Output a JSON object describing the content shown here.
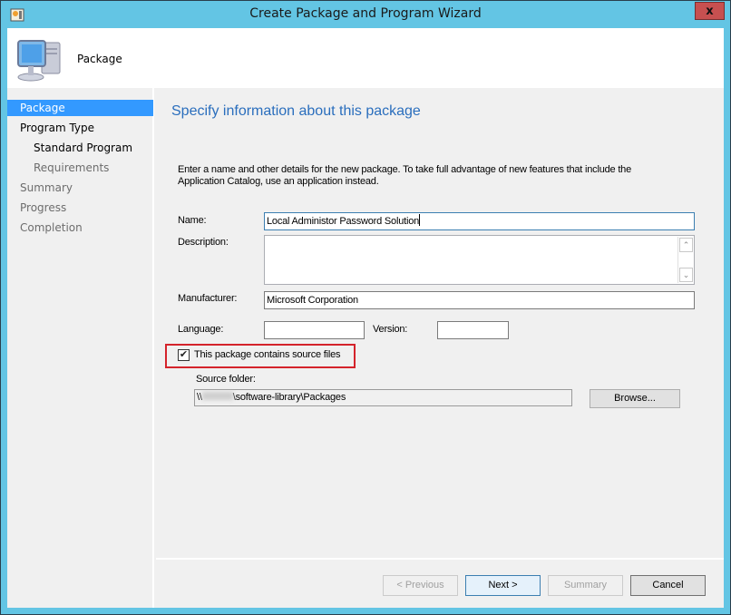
{
  "window": {
    "title": "Create Package and Program Wizard",
    "close_label": "x"
  },
  "header": {
    "title": "Package",
    "icon": "computer-icon"
  },
  "nav": {
    "items": [
      {
        "label": "Package",
        "state": "active"
      },
      {
        "label": "Program Type",
        "state": "normal"
      },
      {
        "label": "Standard Program",
        "state": "sub-normal"
      },
      {
        "label": "Requirements",
        "state": "sub-dim"
      },
      {
        "label": "Summary",
        "state": "dim"
      },
      {
        "label": "Progress",
        "state": "dim"
      },
      {
        "label": "Completion",
        "state": "dim"
      }
    ]
  },
  "page": {
    "heading": "Specify information about this package",
    "intro": "Enter a name and other details for the new package. To take full advantage of new features that include the Application Catalog, use an application instead.",
    "fields": {
      "name_label": "Name:",
      "name_value": "Local Administor Password Solution",
      "description_label": "Description:",
      "description_value": "",
      "manufacturer_label": "Manufacturer:",
      "manufacturer_value": "Microsoft Corporation",
      "language_label": "Language:",
      "language_value": "",
      "version_label": "Version:",
      "version_value": ""
    },
    "source_files": {
      "checkbox_label": "This package contains source files",
      "checked": true,
      "folder_label": "Source folder:",
      "folder_prefix": "\\\\",
      "folder_suffix": "\\software-library\\Packages",
      "browse_label": "Browse..."
    }
  },
  "footer": {
    "previous_label": "< Previous",
    "next_label": "Next >",
    "summary_label": "Summary",
    "cancel_label": "Cancel"
  },
  "colors": {
    "titlebar": "#63c5e4",
    "heading": "#2a6ebd",
    "nav_active": "#3399ff",
    "highlight": "#d4232b",
    "close": "#c75050"
  }
}
